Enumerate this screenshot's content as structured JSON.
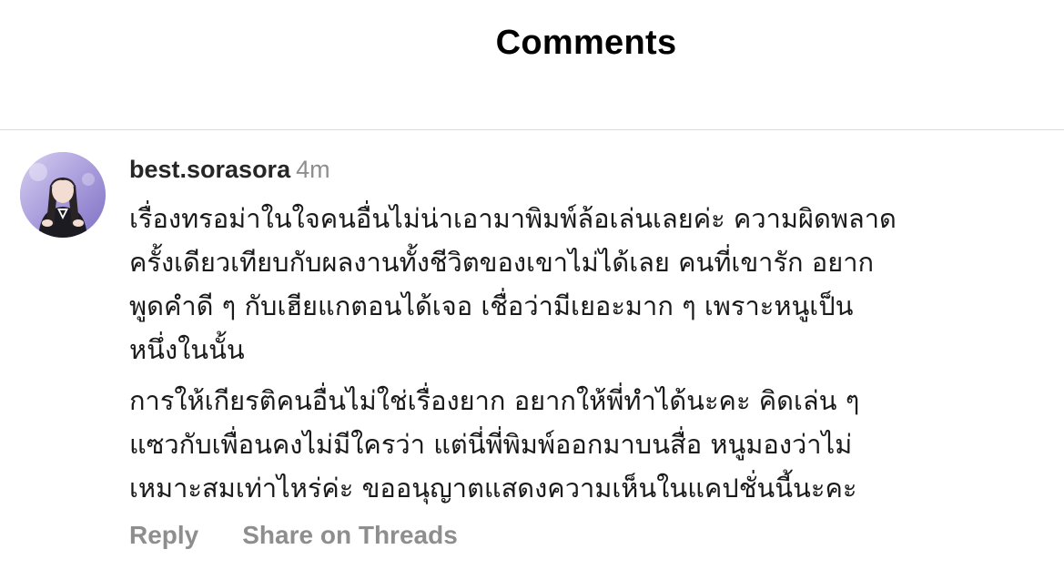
{
  "header": {
    "title": "Comments"
  },
  "comment": {
    "avatar_icon": "user-avatar",
    "username": "best.sorasora",
    "time": "4m",
    "paragraphs": [
      {
        "lines": [
          "เรื่องทรอม่าในใจคนอื่นไม่น่าเอามาพิมพ์ล้อเล่นเลยค่ะ ความผิดพลาด",
          "ครั้งเดียวเทียบกับผลงานทั้งชีวิตของเขาไม่ได้เลย คนที่เขารัก อยาก",
          "พูดคำดี ๆ กับเฮียแกตอนได้เจอ เชื่อว่ามีเยอะมาก ๆ เพราะหนูเป็น",
          "หนึ่งในนั้น"
        ]
      },
      {
        "lines": [
          "การให้เกียรติคนอื่นไม่ใช่เรื่องยาก อยากให้พี่ทำได้นะคะ คิดเล่น ๆ",
          "แซวกับเพื่อนคงไม่มีใครว่า แต่นี่พี่พิมพ์ออกมาบนสื่อ หนูมองว่าไม่",
          "เหมาะสมเท่าไหร่ค่ะ ขออนุญาตแสดงความเห็นในแคปชั่นนี้นะคะ"
        ]
      }
    ],
    "actions": {
      "reply": "Reply",
      "share": "Share on Threads"
    }
  },
  "colors": {
    "text": "#1a1a1a",
    "muted": "#8e8e8e",
    "divider": "#dbdbdb",
    "avatar_bg": "#b9aee0"
  }
}
